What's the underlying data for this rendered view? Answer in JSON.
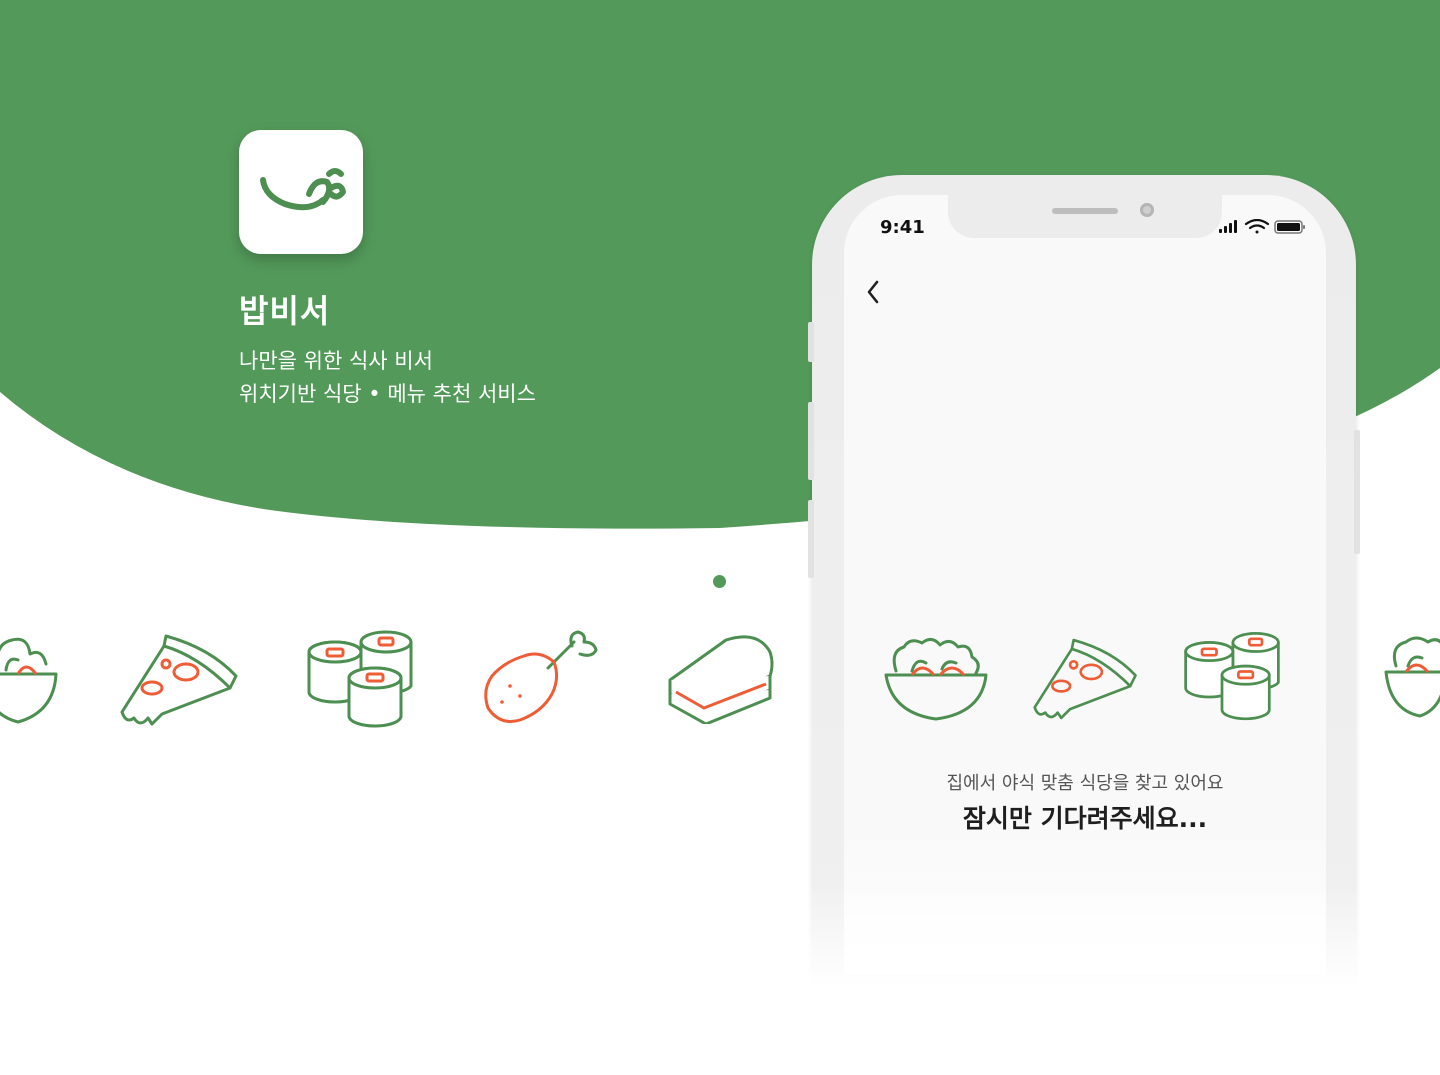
{
  "brand": {
    "name": "밥비서",
    "tagline_line1": "나만을 위한 식사 비서",
    "tagline_line2": "위치기반 식당 • 메뉴 추천 서비스"
  },
  "colors": {
    "brand_green": "#539a5a",
    "icon_green": "#4c8f50",
    "accent_orange": "#ef5d37"
  },
  "food_icons": [
    "salad-icon",
    "pizza-icon",
    "sushi-roll-icon",
    "chicken-leg-icon",
    "sandwich-icon"
  ],
  "phone": {
    "status_time": "9:41",
    "status_icons": [
      "signal-icon",
      "wifi-icon",
      "battery-icon"
    ],
    "back_icon": "chevron-left-icon",
    "loading_message": "집에서 야식 맞춤 식당을 찾고 있어요",
    "loading_wait": "잠시만 기다려주세요..."
  }
}
